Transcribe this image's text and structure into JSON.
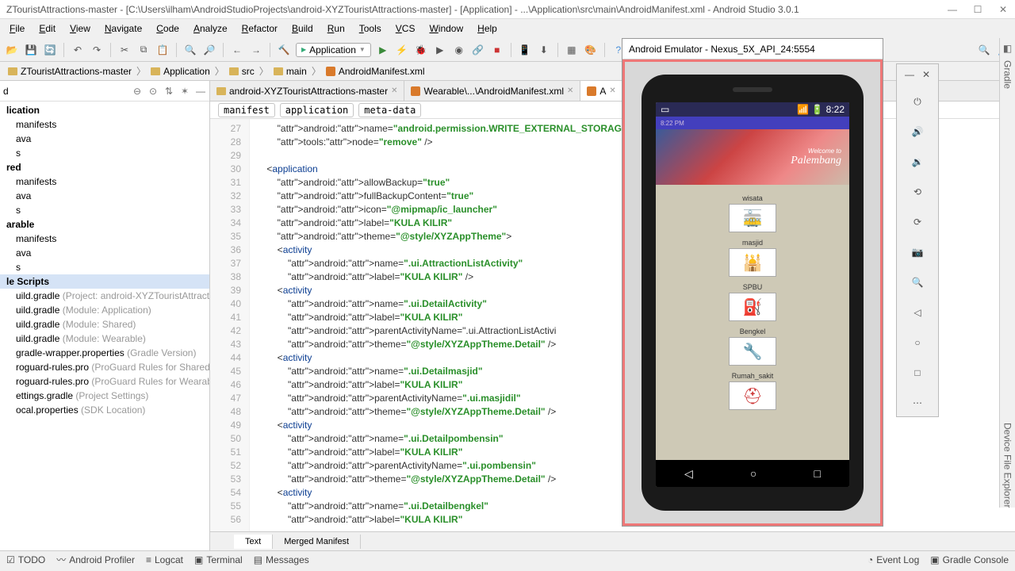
{
  "window": {
    "title": "ZTouristAttractions-master - [C:\\Users\\ilham\\AndroidStudioProjects\\android-XYZTouristAttractions-master] - [Application] - ...\\Application\\src\\main\\AndroidManifest.xml - Android Studio 3.0.1"
  },
  "menu": [
    "File",
    "Edit",
    "View",
    "Navigate",
    "Code",
    "Analyze",
    "Refactor",
    "Build",
    "Run",
    "Tools",
    "VCS",
    "Window",
    "Help"
  ],
  "run_config": "Application",
  "breadcrumb": {
    "root": "ZTouristAttractions-master",
    "app": "Application",
    "src": "src",
    "main": "main",
    "file": "AndroidManifest.xml"
  },
  "tree": [
    {
      "t": "d",
      "b": true
    },
    {
      "t": "lication",
      "b": true,
      "i": 0
    },
    {
      "t": "manifests",
      "i": 1
    },
    {
      "t": "ava",
      "i": 1
    },
    {
      "t": "s",
      "i": 1
    },
    {
      "t": "red",
      "b": true,
      "i": 0
    },
    {
      "t": "manifests",
      "i": 1
    },
    {
      "t": "ava",
      "i": 1
    },
    {
      "t": "s",
      "i": 1
    },
    {
      "t": "arable",
      "b": true,
      "i": 0
    },
    {
      "t": "manifests",
      "i": 1
    },
    {
      "t": "ava",
      "i": 1
    },
    {
      "t": "s",
      "i": 1
    },
    {
      "t": "le Scripts",
      "b": true,
      "sel": true,
      "i": 0
    },
    {
      "t": "uild.gradle",
      "g": " (Project: android-XYZTouristAttraction",
      "i": 1
    },
    {
      "t": "uild.gradle",
      "g": " (Module: Application)",
      "i": 1
    },
    {
      "t": "uild.gradle",
      "g": " (Module: Shared)",
      "i": 1
    },
    {
      "t": "uild.gradle",
      "g": " (Module: Wearable)",
      "i": 1
    },
    {
      "t": "gradle-wrapper.properties",
      "g": " (Gradle Version)",
      "i": 1
    },
    {
      "t": "roguard-rules.pro",
      "g": " (ProGuard Rules for Shared)",
      "i": 1
    },
    {
      "t": "roguard-rules.pro",
      "g": " (ProGuard Rules for Wearable)",
      "i": 1
    },
    {
      "t": "ettings.gradle",
      "g": " (Project Settings)",
      "i": 1
    },
    {
      "t": "ocal.properties",
      "g": " (SDK Location)",
      "i": 1
    }
  ],
  "tabs": [
    {
      "label": "android-XYZTouristAttractions-master",
      "type": "folder"
    },
    {
      "label": "Wearable\\...\\AndroidManifest.xml",
      "type": "xml"
    },
    {
      "label": "A",
      "type": "xml",
      "active": true
    }
  ],
  "crumbs": [
    "manifest",
    "application",
    "meta-data"
  ],
  "code_start": 27,
  "code": [
    "        android:name=\"android.permission.WRITE_EXTERNAL_STORAGE\"",
    "        tools:node=\"remove\" />",
    "",
    "    <application",
    "        android:allowBackup=\"true\"",
    "        android:fullBackupContent=\"true\"",
    "        android:icon=\"@mipmap/ic_launcher\"",
    "        android:label=\"KULA KILIR\"",
    "        android:theme=\"@style/XYZAppTheme\">",
    "        <activity",
    "            android:name=\".ui.AttractionListActivity\"",
    "            android:label=\"KULA KILIR\" />",
    "        <activity",
    "            android:name=\".ui.DetailActivity\"",
    "            android:label=\"KULA KILIR\"",
    "            android:parentActivityName=\".ui.AttractionListActivi",
    "            android:theme=\"@style/XYZAppTheme.Detail\" />",
    "        <activity",
    "            android:name=\".ui.Detailmasjid\"",
    "            android:label=\"KULA KILIR\"",
    "            android:parentActivityName=\".ui.masjidil\"",
    "            android:theme=\"@style/XYZAppTheme.Detail\" />",
    "        <activity",
    "            android:name=\".ui.Detailpombensin\"",
    "            android:label=\"KULA KILIR\"",
    "            android:parentActivityName=\".ui.pombensin\"",
    "            android:theme=\"@style/XYZAppTheme.Detail\" />",
    "        <activity",
    "            android:name=\".ui.Detailbengkel\"",
    "            android:label=\"KULA KILIR\""
  ],
  "bottom_tabs": {
    "text": "Text",
    "merged": "Merged Manifest"
  },
  "status": {
    "todo": "TODO",
    "profiler": "Android Profiler",
    "logcat": "Logcat",
    "terminal": "Terminal",
    "messages": "Messages",
    "eventlog": "Event Log",
    "gradle": "Gradle Console"
  },
  "emulator": {
    "title": "Android Emulator - Nexus_5X_API_24:5554",
    "time": "8:22",
    "clock": "8:22 PM",
    "banner_city": "Palembang",
    "banner_welcome": "Welcome to",
    "items": [
      {
        "label": "wisata",
        "icon": "🚋",
        "bg": "#fff",
        "color": "#c33"
      },
      {
        "label": "masjid",
        "icon": "🕌",
        "bg": "#fff",
        "color": "#2a6b2a"
      },
      {
        "label": "SPBU",
        "icon": "⛽",
        "bg": "#fff",
        "color": "#000"
      },
      {
        "label": "Bengkel",
        "icon": "🔧",
        "bg": "#fff",
        "color": "#000"
      },
      {
        "label": "Rumah_sakit",
        "icon": "⛑",
        "bg": "#fff",
        "color": "#c33"
      }
    ]
  }
}
